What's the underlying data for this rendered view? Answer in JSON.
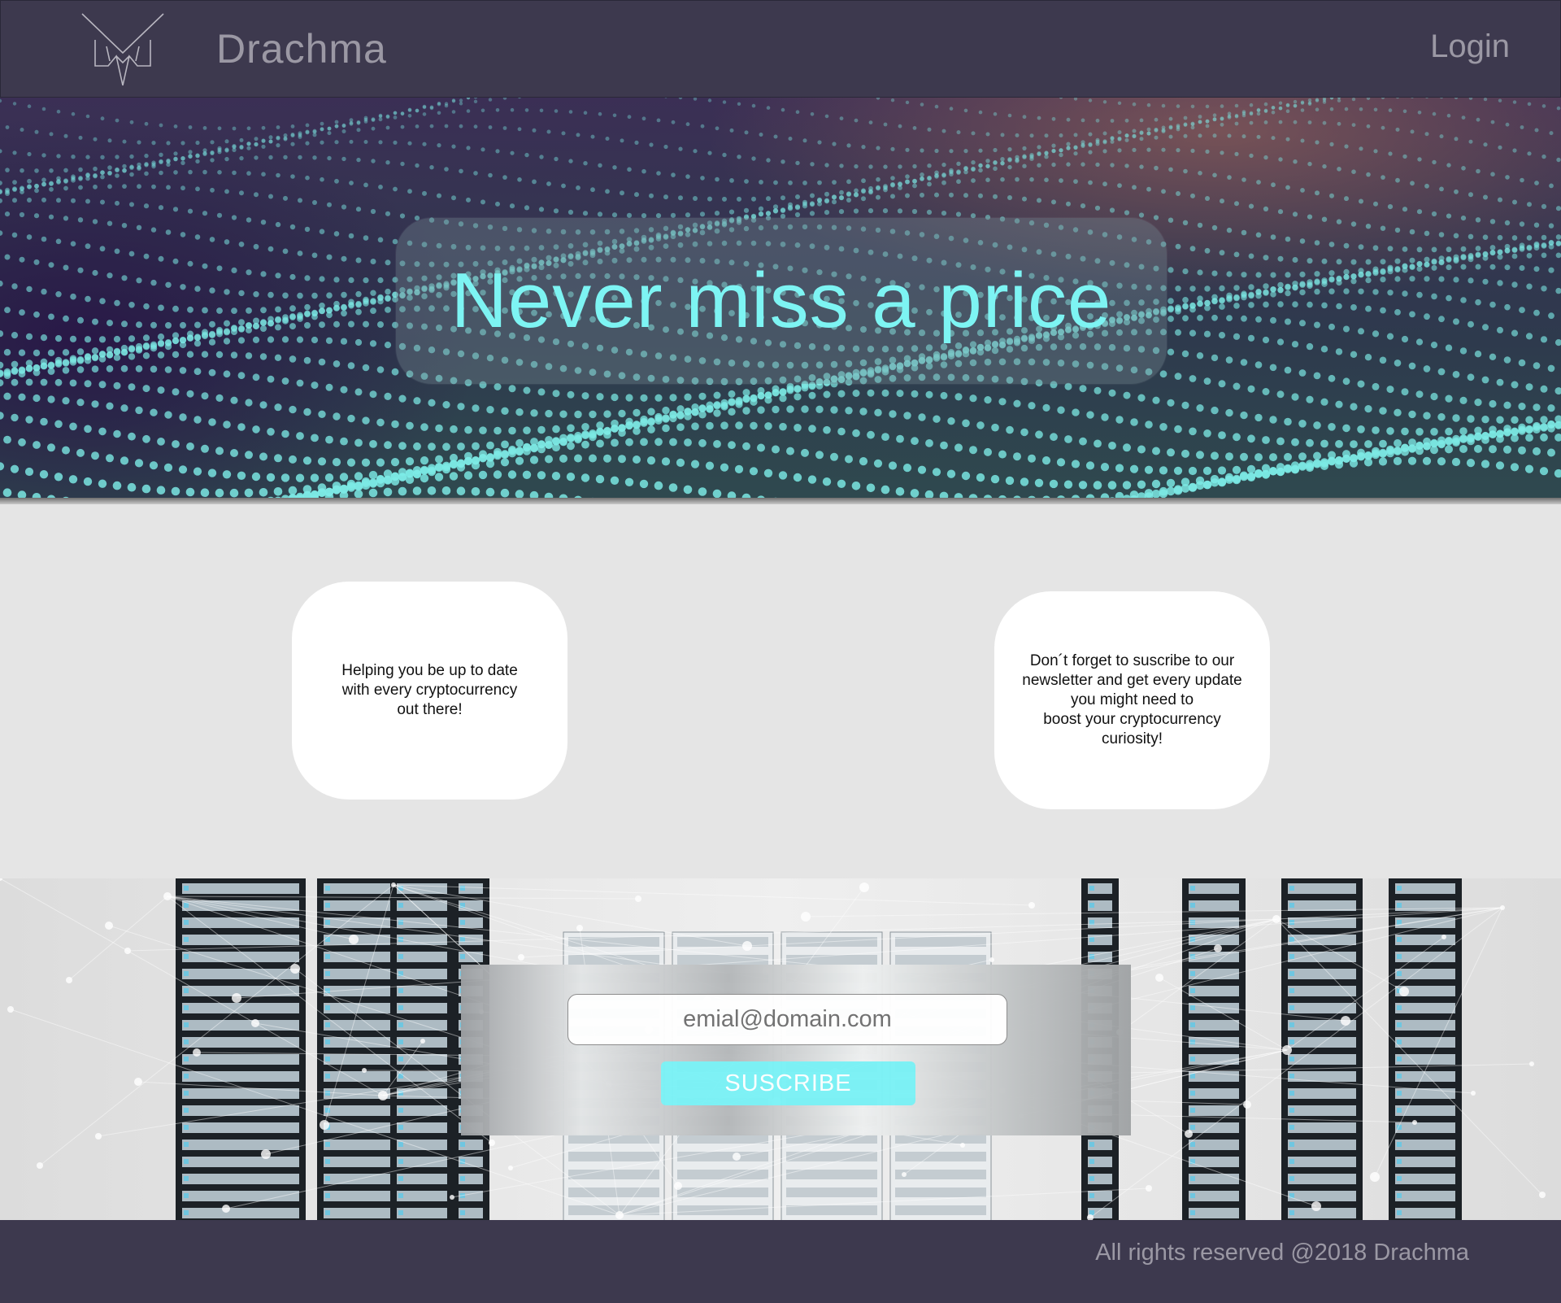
{
  "header": {
    "logo_icon": "owl-logo-icon",
    "brand": "Drachma",
    "login_label": "Login"
  },
  "hero": {
    "title": "Never miss a price",
    "accent_color": "#7df4f3"
  },
  "info": {
    "cards": [
      {
        "text": "Helping you be up to date\nwith every cryptocurrency\nout there!"
      },
      {
        "text": "Don´t forget to suscribe to our\nnewsletter and get every update\nyou might need to\nboost your cryptocurrency\ncuriosity!"
      }
    ]
  },
  "newsletter": {
    "email_placeholder": "emial@domain.com",
    "subscribe_label": "SUSCRIBE",
    "button_color": "#7af2f6"
  },
  "footer": {
    "copyright": "All rights reserved @2018 Drachma"
  }
}
